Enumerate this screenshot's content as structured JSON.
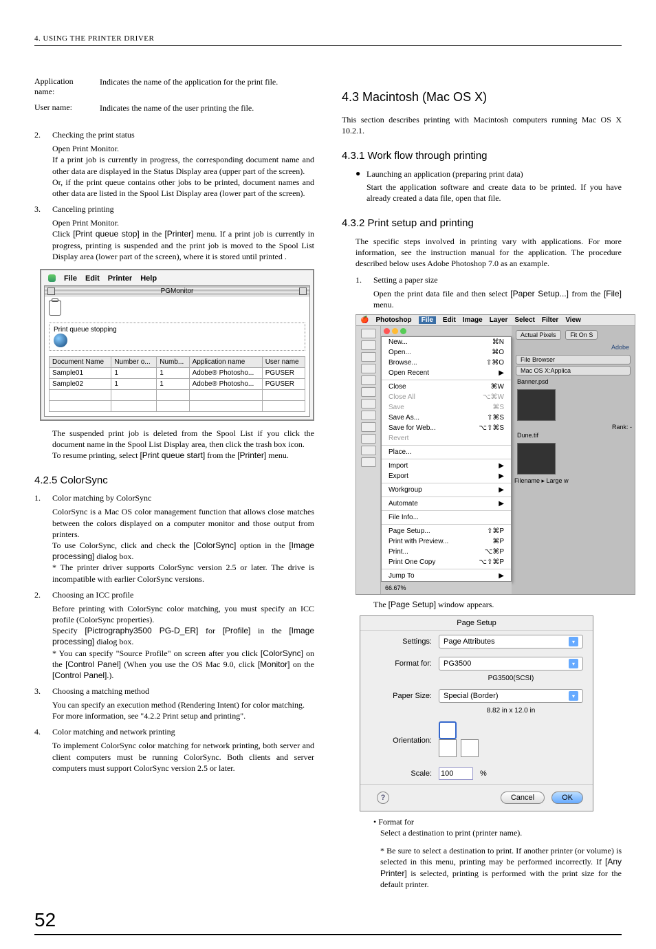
{
  "header": "4. USING THE PRINTER DRIVER",
  "page_number": "52",
  "left": {
    "defs": [
      {
        "term": "Application name:",
        "def": "Indicates the name of the application for the print file."
      },
      {
        "term": "User name:",
        "def": "Indicates the name of the user printing the file."
      }
    ],
    "item2": {
      "n": "2.",
      "title": "Checking the print status",
      "l1": "Open Print Monitor.",
      "l2": "If a print job is currently in progress, the corresponding document name and other data are displayed in the Status Display area (upper part of the screen).",
      "l3": "Or, if the print queue contains other jobs to be printed, document names and other data are listed in the Spool List Display area (lower part of the screen)."
    },
    "item3": {
      "n": "3.",
      "title": "Canceling printing",
      "l1": "Open Print Monitor.",
      "l2a": "Click ",
      "l2b": "[Print queue stop]",
      "l2c": " in the ",
      "l2d": "[Printer]",
      "l2e": " menu. If a print job is currently in progress, printing is suspended and the print job is moved to the Spool List Display area (lower part of the screen), where it is stored until printed ."
    },
    "pgmon": {
      "menus": [
        "File",
        "Edit",
        "Printer",
        "Help"
      ],
      "title": "PGMonitor",
      "status": "Print queue stopping",
      "cols": [
        "Document Name",
        "Number o...",
        "Numb...",
        "Application name",
        "User name"
      ],
      "rows": [
        [
          "Sample01",
          "1",
          "1",
          "Adobe® Photosho...",
          "PGUSER"
        ],
        [
          "Sample02",
          "1",
          "1",
          "Adobe® Photosho...",
          "PGUSER"
        ]
      ]
    },
    "after_fig": {
      "p1": "The suspended print job is deleted from the Spool List if you click the document name in the Spool List Display area, then click the trash box icon.",
      "p2a": "To resume printing, select ",
      "p2b": "[Print queue start]",
      "p2c": " from the ",
      "p2d": "[Printer]",
      "p2e": " menu."
    },
    "sec425": {
      "title": "4.2.5   ColorSync",
      "i1": {
        "n": "1.",
        "t": "Color matching by ColorSync",
        "p1": "ColorSync is a Mac OS color management function that allows close matches between the colors displayed on a computer monitor and those output from printers.",
        "p2a": "To use ColorSync, click and check the ",
        "p2b": "[ColorSync]",
        "p2c": " option in the ",
        "p2d": "[Image processing]",
        "p2e": " dialog box.",
        "p3": "* The printer driver supports ColorSync version 2.5 or later. The drive is incompatible with earlier ColorSync versions."
      },
      "i2": {
        "n": "2.",
        "t": "Choosing an ICC profile",
        "p1": "Before printing with ColorSync color matching, you must specify an ICC profile (ColorSync properties).",
        "p2a": "Specify ",
        "p2b": "[Pictrography3500 PG-D_ER]",
        "p2c": " for ",
        "p2d": "[Profile]",
        "p2e": " in the ",
        "p2f": "[Image processing]",
        "p2g": " dialog box.",
        "p3a": "* You can specify \"Source Profile\" on screen after you click ",
        "p3b": "[ColorSync]",
        "p3c": " on the ",
        "p3d": "[Control Panel]",
        "p3e": " (When you use the OS Mac 9.0, click ",
        "p3f": "[Monitor]",
        "p3g": " on the ",
        "p3h": "[Control Panel]",
        "p3i": ".)."
      },
      "i3": {
        "n": "3.",
        "t": "Choosing a matching method",
        "p1": "You can specify an execution method (Rendering Intent) for color matching.",
        "p2": "For more information, see \"4.2.2 Print setup and printing\"."
      },
      "i4": {
        "n": "4.",
        "t": "Color matching and network printing",
        "p1": "To implement ColorSync color matching for network printing, both server and client computers must be running ColorSync. Both clients and server computers must support ColorSync version 2.5 or later."
      }
    }
  },
  "right": {
    "h43": "4.3  Macintosh (Mac OS X)",
    "intro": "This section describes printing with Macintosh computers running Mac OS X 10.2.1.",
    "h431": "4.3.1   Work flow through printing",
    "bul1": {
      "t": "Launching an application (preparing print data)",
      "p": "Start the application software and create data to be printed. If you have already created a data file, open that file."
    },
    "h432": "4.3.2   Print setup and printing",
    "p432": "The specific steps involved in printing vary with applications. For more information, see the instruction manual for the application. The procedure described below uses Adobe Photoshop 7.0 as an example.",
    "s1": {
      "n": "1.",
      "t": "Setting a paper size",
      "pa": "Open the print data file and then select ",
      "pb": "[Paper Setup...]",
      "pc": " from the ",
      "pd": "[File]",
      "pe": " menu."
    },
    "psbar": [
      "Photoshop",
      "File",
      "Edit",
      "Image",
      "Layer",
      "Select",
      "Filter",
      "View"
    ],
    "psmenu": [
      {
        "l": "New...",
        "s": "⌘N"
      },
      {
        "l": "Open...",
        "s": "⌘O"
      },
      {
        "l": "Browse...",
        "s": "⇧⌘O"
      },
      {
        "l": "Open Recent",
        "s": "▶"
      },
      {
        "sep": true
      },
      {
        "l": "Close",
        "s": "⌘W"
      },
      {
        "l": "Close All",
        "s": "⌥⌘W",
        "dim": true
      },
      {
        "l": "Save",
        "s": "⌘S",
        "dim": true
      },
      {
        "l": "Save As...",
        "s": "⇧⌘S"
      },
      {
        "l": "Save for Web...",
        "s": "⌥⇧⌘S"
      },
      {
        "l": "Revert",
        "dim": true
      },
      {
        "sep": true
      },
      {
        "l": "Place..."
      },
      {
        "sep": true
      },
      {
        "l": "Import",
        "s": "▶"
      },
      {
        "l": "Export",
        "s": "▶"
      },
      {
        "sep": true
      },
      {
        "l": "Workgroup",
        "s": "▶"
      },
      {
        "sep": true
      },
      {
        "l": "Automate",
        "s": "▶"
      },
      {
        "sep": true
      },
      {
        "l": "File Info..."
      },
      {
        "sep": true
      },
      {
        "l": "Page Setup...",
        "s": "⇧⌘P"
      },
      {
        "l": "Print with Preview...",
        "s": "⌘P"
      },
      {
        "l": "Print...",
        "s": "⌥⌘P"
      },
      {
        "l": "Print One Copy",
        "s": "⌥⇧⌘P"
      },
      {
        "sep": true
      },
      {
        "l": "Jump To",
        "s": "▶"
      }
    ],
    "pspct": "66.67%",
    "rlabels": {
      "ap": "Actual Pixels",
      "fo": "Fit On S",
      "adobe": "Adobe",
      "fb": "File Browser",
      "mac": "Mac OS X:Applica",
      "bn": "Banner.psd",
      "rk": "Rank:  -",
      "dn": "Dune.tif",
      "fn": "Filename",
      "lg": "Large w"
    },
    "caption": {
      "a": "The ",
      "b": "[Page Setup]",
      "c": " window appears."
    },
    "dlg": {
      "title": "Page Setup",
      "settings_l": "Settings:",
      "settings_v": "Page Attributes",
      "format_l": "Format for:",
      "format_v": "PG3500",
      "format_sub": "PG3500(SCSI)",
      "paper_l": "Paper Size:",
      "paper_v": "Special (Border)",
      "paper_sub": "8.82 in x 12.0 in",
      "orient_l": "Orientation:",
      "scale_l": "Scale:",
      "scale_v": "100",
      "scale_u": "%",
      "cancel": "Cancel",
      "ok": "OK",
      "help": "?"
    },
    "note1": {
      "t": "Format for",
      "p": "Select a destination to print (printer name)."
    },
    "note2a": "* Be sure to select a destination to print. If another printer (or volume) is selected in this menu, printing may be performed incorrectly. If ",
    "note2b": "[Any Printer]",
    "note2c": " is selected, printing is performed with the print size for the default printer."
  }
}
